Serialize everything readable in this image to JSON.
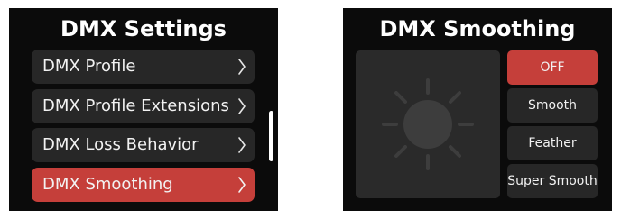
{
  "settings_screen": {
    "title": "DMX Settings",
    "items": [
      {
        "label": "DMX Profile",
        "active": false
      },
      {
        "label": "DMX Profile Extensions",
        "active": false
      },
      {
        "label": "DMX Loss Behavior",
        "active": false
      },
      {
        "label": "DMX Smoothing",
        "active": true
      }
    ]
  },
  "smoothing_screen": {
    "title": "DMX Smoothing",
    "options": [
      {
        "label": "OFF",
        "selected": true
      },
      {
        "label": "Smooth",
        "selected": false
      },
      {
        "label": "Feather",
        "selected": false
      },
      {
        "label": "Super Smooth",
        "selected": false
      }
    ]
  },
  "colors": {
    "accent": "#c53f3a",
    "screen_bg": "#0b0b0b",
    "item_bg": "#272727",
    "preview_bg": "#2a2a2a",
    "icon": "#3d3d3d"
  },
  "icons": {
    "chevron": "chevron-right-icon",
    "preview": "sun-icon"
  }
}
